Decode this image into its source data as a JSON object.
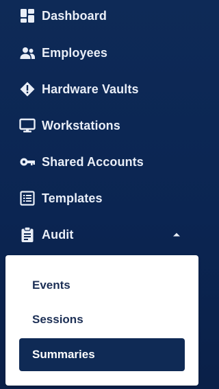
{
  "nav": {
    "items": [
      {
        "label": "Dashboard",
        "icon": "dashboard-icon"
      },
      {
        "label": "Employees",
        "icon": "users-icon"
      },
      {
        "label": "Hardware Vaults",
        "icon": "vault-diamond-icon"
      },
      {
        "label": "Workstations",
        "icon": "monitor-icon"
      },
      {
        "label": "Shared Accounts",
        "icon": "key-icon"
      },
      {
        "label": "Templates",
        "icon": "list-icon"
      },
      {
        "label": "Audit",
        "icon": "clipboard-icon",
        "expanded": true
      }
    ],
    "audit_submenu": [
      {
        "label": "Events"
      },
      {
        "label": "Sessions"
      },
      {
        "label": "Summaries",
        "active": true
      }
    ]
  },
  "colors": {
    "sidebar_bg": "#0b2552",
    "text": "#e9eef7",
    "submenu_bg": "#ffffff",
    "submenu_text": "#1c2f55",
    "active_bg": "#0f2a55"
  }
}
